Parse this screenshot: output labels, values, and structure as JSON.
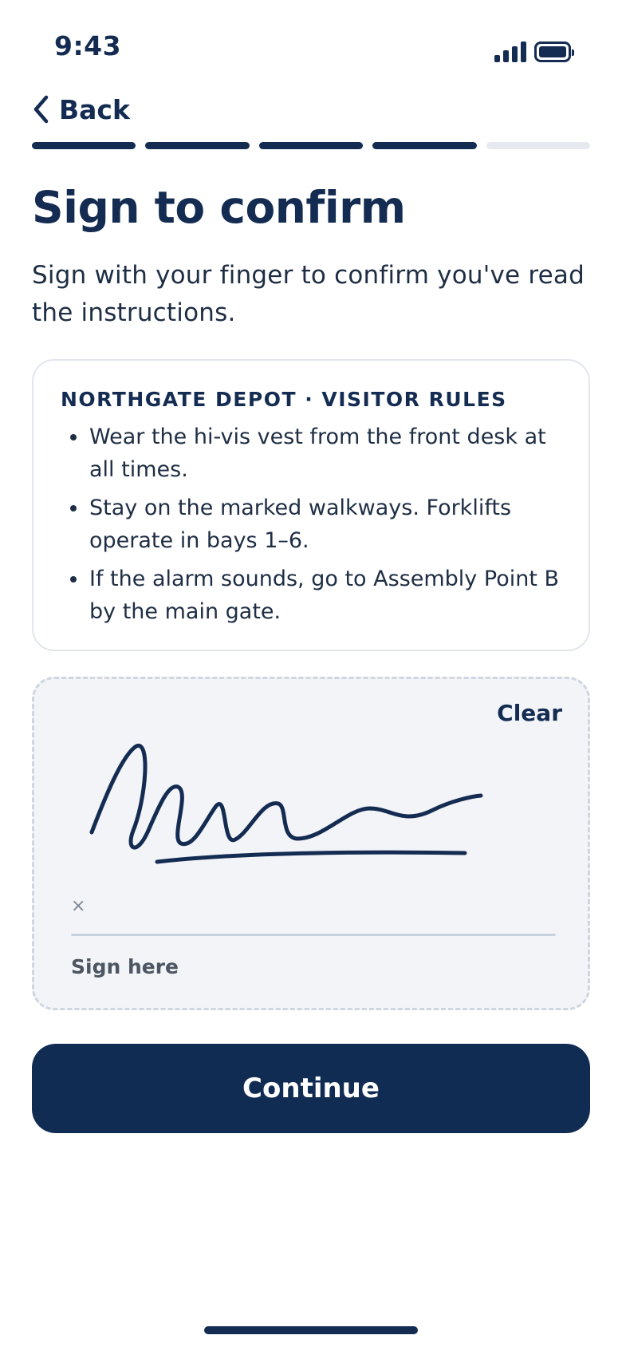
{
  "status_bar": {
    "time": "9:43"
  },
  "nav": {
    "back_label": "Back"
  },
  "progress": {
    "total_steps": 5,
    "completed_steps": 4
  },
  "page": {
    "title": "Sign to confirm",
    "subtitle": "Sign with your finger to confirm you've read the instructions."
  },
  "rules": {
    "heading": "NORTHGATE DEPOT · VISITOR RULES",
    "items": [
      "Wear the hi-vis vest from the front desk at all times.",
      "Stay on the marked walkways. Forklifts operate in bays 1–6.",
      "If the alarm sounds, go to Assembly Point B by the main gate."
    ]
  },
  "signature": {
    "clear_label": "Clear",
    "marker": "×",
    "hint": "Sign here"
  },
  "actions": {
    "continue_label": "Continue"
  },
  "colors": {
    "primary": "#112c53",
    "pad_background": "#f2f4f7",
    "progress_inactive": "#e6eaf0"
  }
}
